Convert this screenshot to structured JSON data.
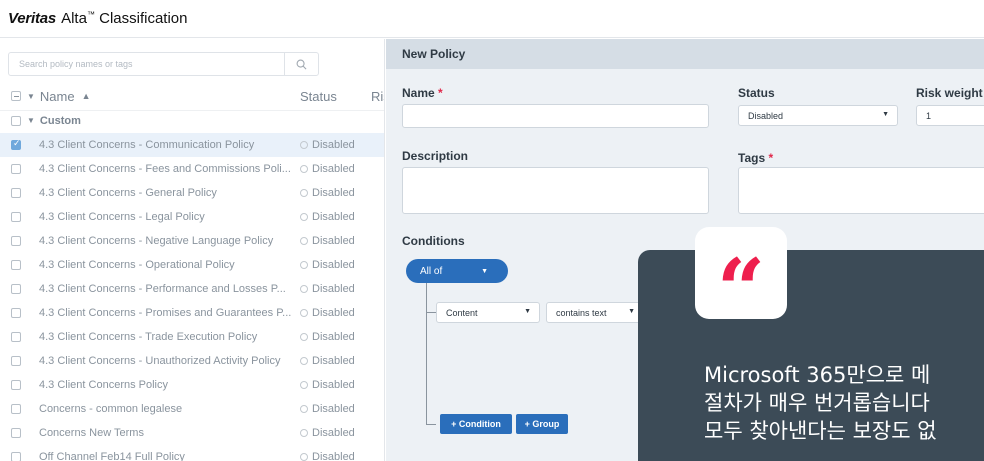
{
  "header": {
    "brand": "Veritas",
    "product": "Alta",
    "tm": "™",
    "product_suffix": "Classification"
  },
  "search": {
    "placeholder": "Search policy names or tags",
    "icon": "search-icon"
  },
  "columns": {
    "name": "Name",
    "status": "Status",
    "risk": "Ris"
  },
  "group": {
    "label": "Custom"
  },
  "policies": [
    {
      "name": "4.3 Client Concerns - Communication Policy",
      "status": "Disabled",
      "checked": true
    },
    {
      "name": "4.3 Client Concerns - Fees and Commissions Poli...",
      "status": "Disabled"
    },
    {
      "name": "4.3 Client Concerns - General Policy",
      "status": "Disabled"
    },
    {
      "name": "4.3 Client Concerns - Legal Policy",
      "status": "Disabled"
    },
    {
      "name": "4.3 Client Concerns - Negative Language Policy",
      "status": "Disabled"
    },
    {
      "name": "4.3 Client Concerns - Operational Policy",
      "status": "Disabled"
    },
    {
      "name": "4.3 Client Concerns - Performance and Losses P...",
      "status": "Disabled"
    },
    {
      "name": "4.3 Client Concerns - Promises and Guarantees P...",
      "status": "Disabled"
    },
    {
      "name": "4.3 Client Concerns - Trade Execution Policy",
      "status": "Disabled"
    },
    {
      "name": "4.3 Client Concerns - Unauthorized Activity Policy",
      "status": "Disabled"
    },
    {
      "name": "4.3 Client Concerns Policy",
      "status": "Disabled"
    },
    {
      "name": "Concerns - common legalese",
      "status": "Disabled"
    },
    {
      "name": "Concerns New Terms",
      "status": "Disabled"
    },
    {
      "name": "Off Channel Feb14 Full Policy",
      "status": "Disabled"
    }
  ],
  "form": {
    "title": "New Policy",
    "name_label": "Name",
    "status_label": "Status",
    "status_value": "Disabled",
    "risk_label": "Risk weight",
    "risk_value": "1",
    "description_label": "Description",
    "tags_label": "Tags",
    "required_mark": "*",
    "conditions_label": "Conditions",
    "all_of": "All of",
    "condition_field": "Content",
    "condition_operator": "contains text",
    "add_condition": "+ Condition",
    "add_group": "+ Group"
  },
  "quote": {
    "mark": "“",
    "lines": [
      "Microsoft 365만으로 메",
      "절차가 매우 번거롭습니다",
      "모두 찾아낸다는 보장도 없"
    ]
  },
  "colors": {
    "accent": "#2a6ebb",
    "quote_red": "#ee1f4d",
    "quote_bg": "#3c4b57"
  }
}
